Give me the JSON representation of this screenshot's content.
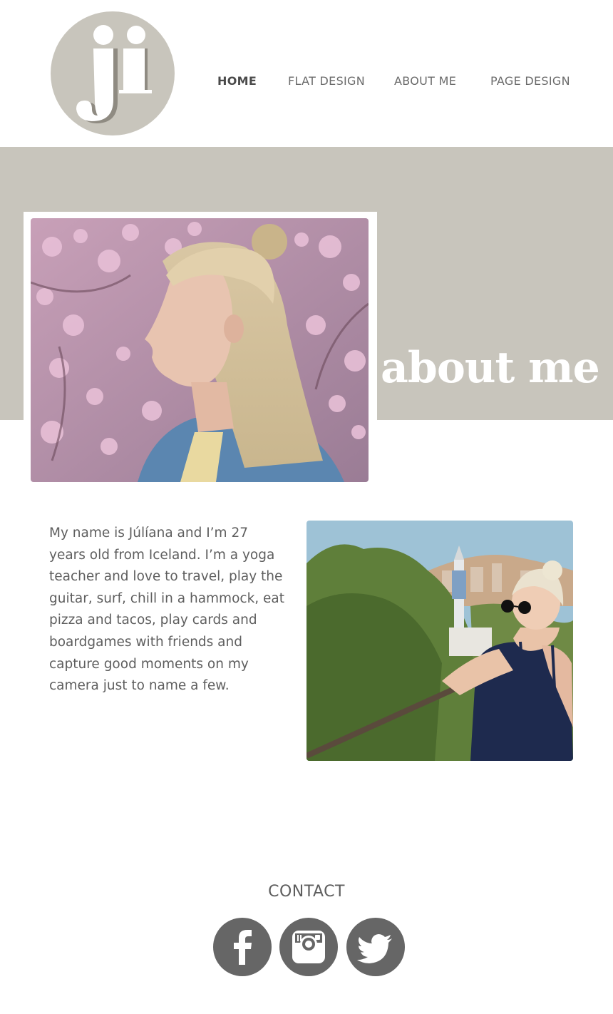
{
  "logo": {
    "monogram": "ji"
  },
  "nav": {
    "items": [
      {
        "label": "HOME",
        "active": true
      },
      {
        "label": "FLAT DESIGN",
        "active": false
      },
      {
        "label": "ABOUT ME",
        "active": false
      },
      {
        "label": "PAGE DESIGN",
        "active": false
      }
    ]
  },
  "hero": {
    "title": "about me"
  },
  "bio": {
    "lines": [
      "My name is Júlíana and I’m 27",
      "years old from Iceland. I’m a yoga",
      "teacher and love to travel, play the",
      "guitar, surf, chill in a hammock, eat",
      "pizza and tacos, play cards and",
      "boardgames with friends and",
      "capture good moments on my",
      "camera just to name a few."
    ]
  },
  "contact": {
    "label": "CONTACT",
    "social": [
      {
        "icon": "facebook-icon"
      },
      {
        "icon": "instagram-icon"
      },
      {
        "icon": "twitter-icon"
      }
    ]
  },
  "colors": {
    "band": "#c8c5bc",
    "icon": "#666666",
    "text": "#5e5e5e"
  }
}
